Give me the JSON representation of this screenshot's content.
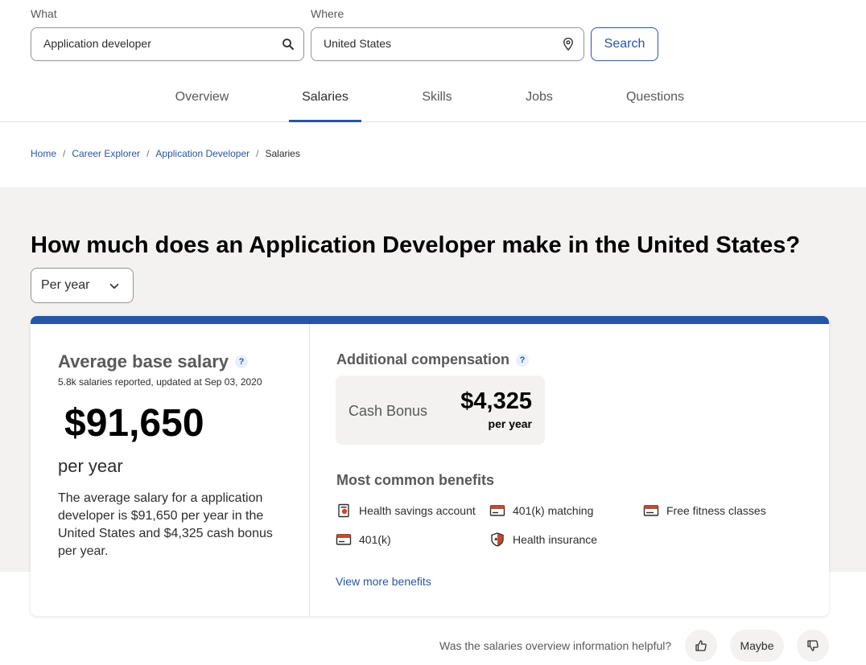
{
  "search": {
    "what_label": "What",
    "what_value": "Application developer",
    "where_label": "Where",
    "where_value": "United States",
    "button_label": "Search"
  },
  "tabs": [
    {
      "label": "Overview"
    },
    {
      "label": "Salaries",
      "active": true
    },
    {
      "label": "Skills"
    },
    {
      "label": "Jobs"
    },
    {
      "label": "Questions"
    }
  ],
  "breadcrumb": [
    {
      "label": "Home"
    },
    {
      "label": "Career Explorer"
    },
    {
      "label": "Application Developer"
    },
    {
      "label": "Salaries",
      "current": true
    }
  ],
  "page_title": "How much does an Application Developer make in the United States?",
  "period_select": {
    "value": "Per year"
  },
  "salary_card": {
    "avg_title": "Average base salary",
    "help_glyph": "?",
    "meta": "5.8k salaries reported, updated at Sep 03, 2020",
    "amount": "$91,650",
    "period": "per year",
    "description": "The average salary for a application developer is $91,650 per year in the United States and $4,325 cash bonus per year."
  },
  "additional": {
    "title": "Additional compensation",
    "help_glyph": "?",
    "bonus_label": "Cash Bonus",
    "bonus_amount": "$4,325",
    "bonus_period": "per year"
  },
  "benefits": {
    "title": "Most common benefits",
    "items": [
      {
        "label": "Health savings account",
        "icon": "piggy-bank-icon"
      },
      {
        "label": "401(k) matching",
        "icon": "retirement-icon"
      },
      {
        "label": "Free fitness classes",
        "icon": "fitness-icon"
      },
      {
        "label": "401(k)",
        "icon": "retirement-icon"
      },
      {
        "label": "Health insurance",
        "icon": "shield-plus-icon"
      }
    ],
    "more_link": "View more benefits"
  },
  "feedback": {
    "question": "Was the salaries overview information helpful?",
    "maybe_label": "Maybe"
  },
  "colors": {
    "accent": "#2557a7",
    "band": "#f3f2f1",
    "benefit_icon": "#c9482b"
  }
}
